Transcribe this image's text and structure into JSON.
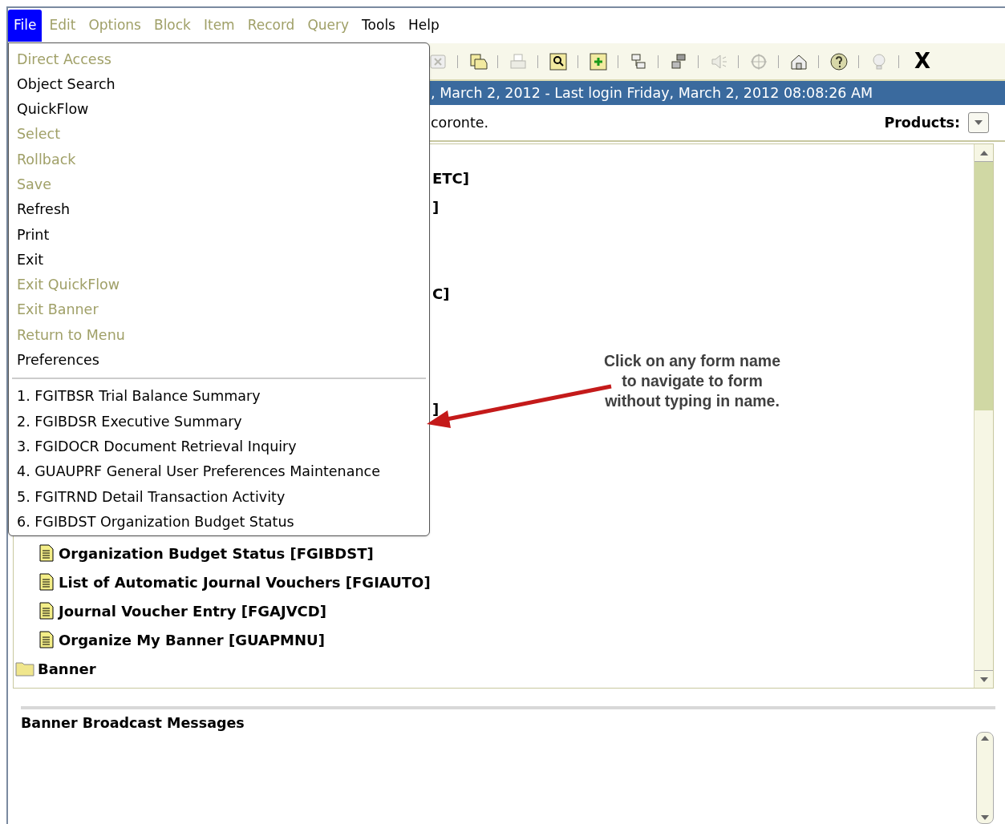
{
  "menubar": [
    {
      "label": "File",
      "selected": true,
      "disabled": false
    },
    {
      "label": "Edit",
      "selected": false,
      "disabled": true
    },
    {
      "label": "Options",
      "selected": false,
      "disabled": true
    },
    {
      "label": "Block",
      "selected": false,
      "disabled": true
    },
    {
      "label": "Item",
      "selected": false,
      "disabled": true
    },
    {
      "label": "Record",
      "selected": false,
      "disabled": true
    },
    {
      "label": "Query",
      "selected": false,
      "disabled": true
    },
    {
      "label": "Tools",
      "selected": false,
      "disabled": false
    },
    {
      "label": "Help",
      "selected": false,
      "disabled": false
    }
  ],
  "toolbar": {
    "buttons": [
      {
        "kind": "delete",
        "disabled": true
      },
      {
        "kind": "copy",
        "disabled": false
      },
      {
        "kind": "print",
        "disabled": true
      },
      {
        "kind": "search",
        "disabled": false
      },
      {
        "kind": "insert",
        "disabled": false
      },
      {
        "kind": "previous-block",
        "disabled": false
      },
      {
        "kind": "next-block",
        "disabled": false
      },
      {
        "kind": "sound",
        "disabled": true
      },
      {
        "kind": "target",
        "disabled": true
      },
      {
        "kind": "home",
        "disabled": false
      },
      {
        "kind": "help",
        "disabled": false
      },
      {
        "kind": "bulb",
        "disabled": true
      }
    ],
    "close_label": "X"
  },
  "status_bar": ", March 2, 2012 - Last login Friday, March 2, 2012 08:08:26 AM",
  "greeting": "coronte.",
  "products_label": "Products:",
  "tree": [
    {
      "kind": "covered",
      "text": "ETC]"
    },
    {
      "kind": "covered",
      "text": "]"
    },
    {
      "kind": "covered"
    },
    {
      "kind": "covered"
    },
    {
      "kind": "covered",
      "text": "C]"
    },
    {
      "kind": "covered"
    },
    {
      "kind": "covered"
    },
    {
      "kind": "covered"
    },
    {
      "kind": "covered",
      "text": "]"
    },
    {
      "kind": "covered"
    },
    {
      "kind": "covered"
    },
    {
      "kind": "covered"
    },
    {
      "kind": "covered"
    },
    {
      "kind": "leaf",
      "text": "Organization Budget Status [FGIBDST]"
    },
    {
      "kind": "leaf",
      "text": "List of Automatic Journal Vouchers [FGIAUTO]"
    },
    {
      "kind": "leaf",
      "text": "Journal Voucher Entry [FGAJVCD]"
    },
    {
      "kind": "leaf",
      "text": "Organize My Banner [GUAPMNU]"
    },
    {
      "kind": "folder",
      "text": "Banner"
    }
  ],
  "file_menu": {
    "items": [
      {
        "label": "Direct Access",
        "disabled": true
      },
      {
        "label": "Object Search",
        "disabled": false
      },
      {
        "label": "QuickFlow",
        "disabled": false
      },
      {
        "label": "Select",
        "disabled": true
      },
      {
        "label": "Rollback",
        "disabled": true
      },
      {
        "label": "Save",
        "disabled": true
      },
      {
        "label": "Refresh",
        "disabled": false
      },
      {
        "label": "Print",
        "disabled": false
      },
      {
        "label": "Exit",
        "disabled": false
      },
      {
        "label": "Exit QuickFlow",
        "disabled": true
      },
      {
        "label": "Exit Banner",
        "disabled": true
      },
      {
        "label": "Return to Menu",
        "disabled": true
      },
      {
        "label": "Preferences",
        "disabled": false
      }
    ],
    "recent": [
      "1. FGITBSR Trial Balance Summary",
      "2. FGIBDSR Executive Summary",
      "3. FGIDOCR Document Retrieval Inquiry",
      "4. GUAUPRF General User Preferences Maintenance",
      "5. FGITRND Detail Transaction Activity",
      "6. FGIBDST Organization Budget Status"
    ]
  },
  "annotation": "Click on any form name to navigate to form without typing in name.",
  "broadcast": {
    "title": "Banner Broadcast Messages"
  }
}
